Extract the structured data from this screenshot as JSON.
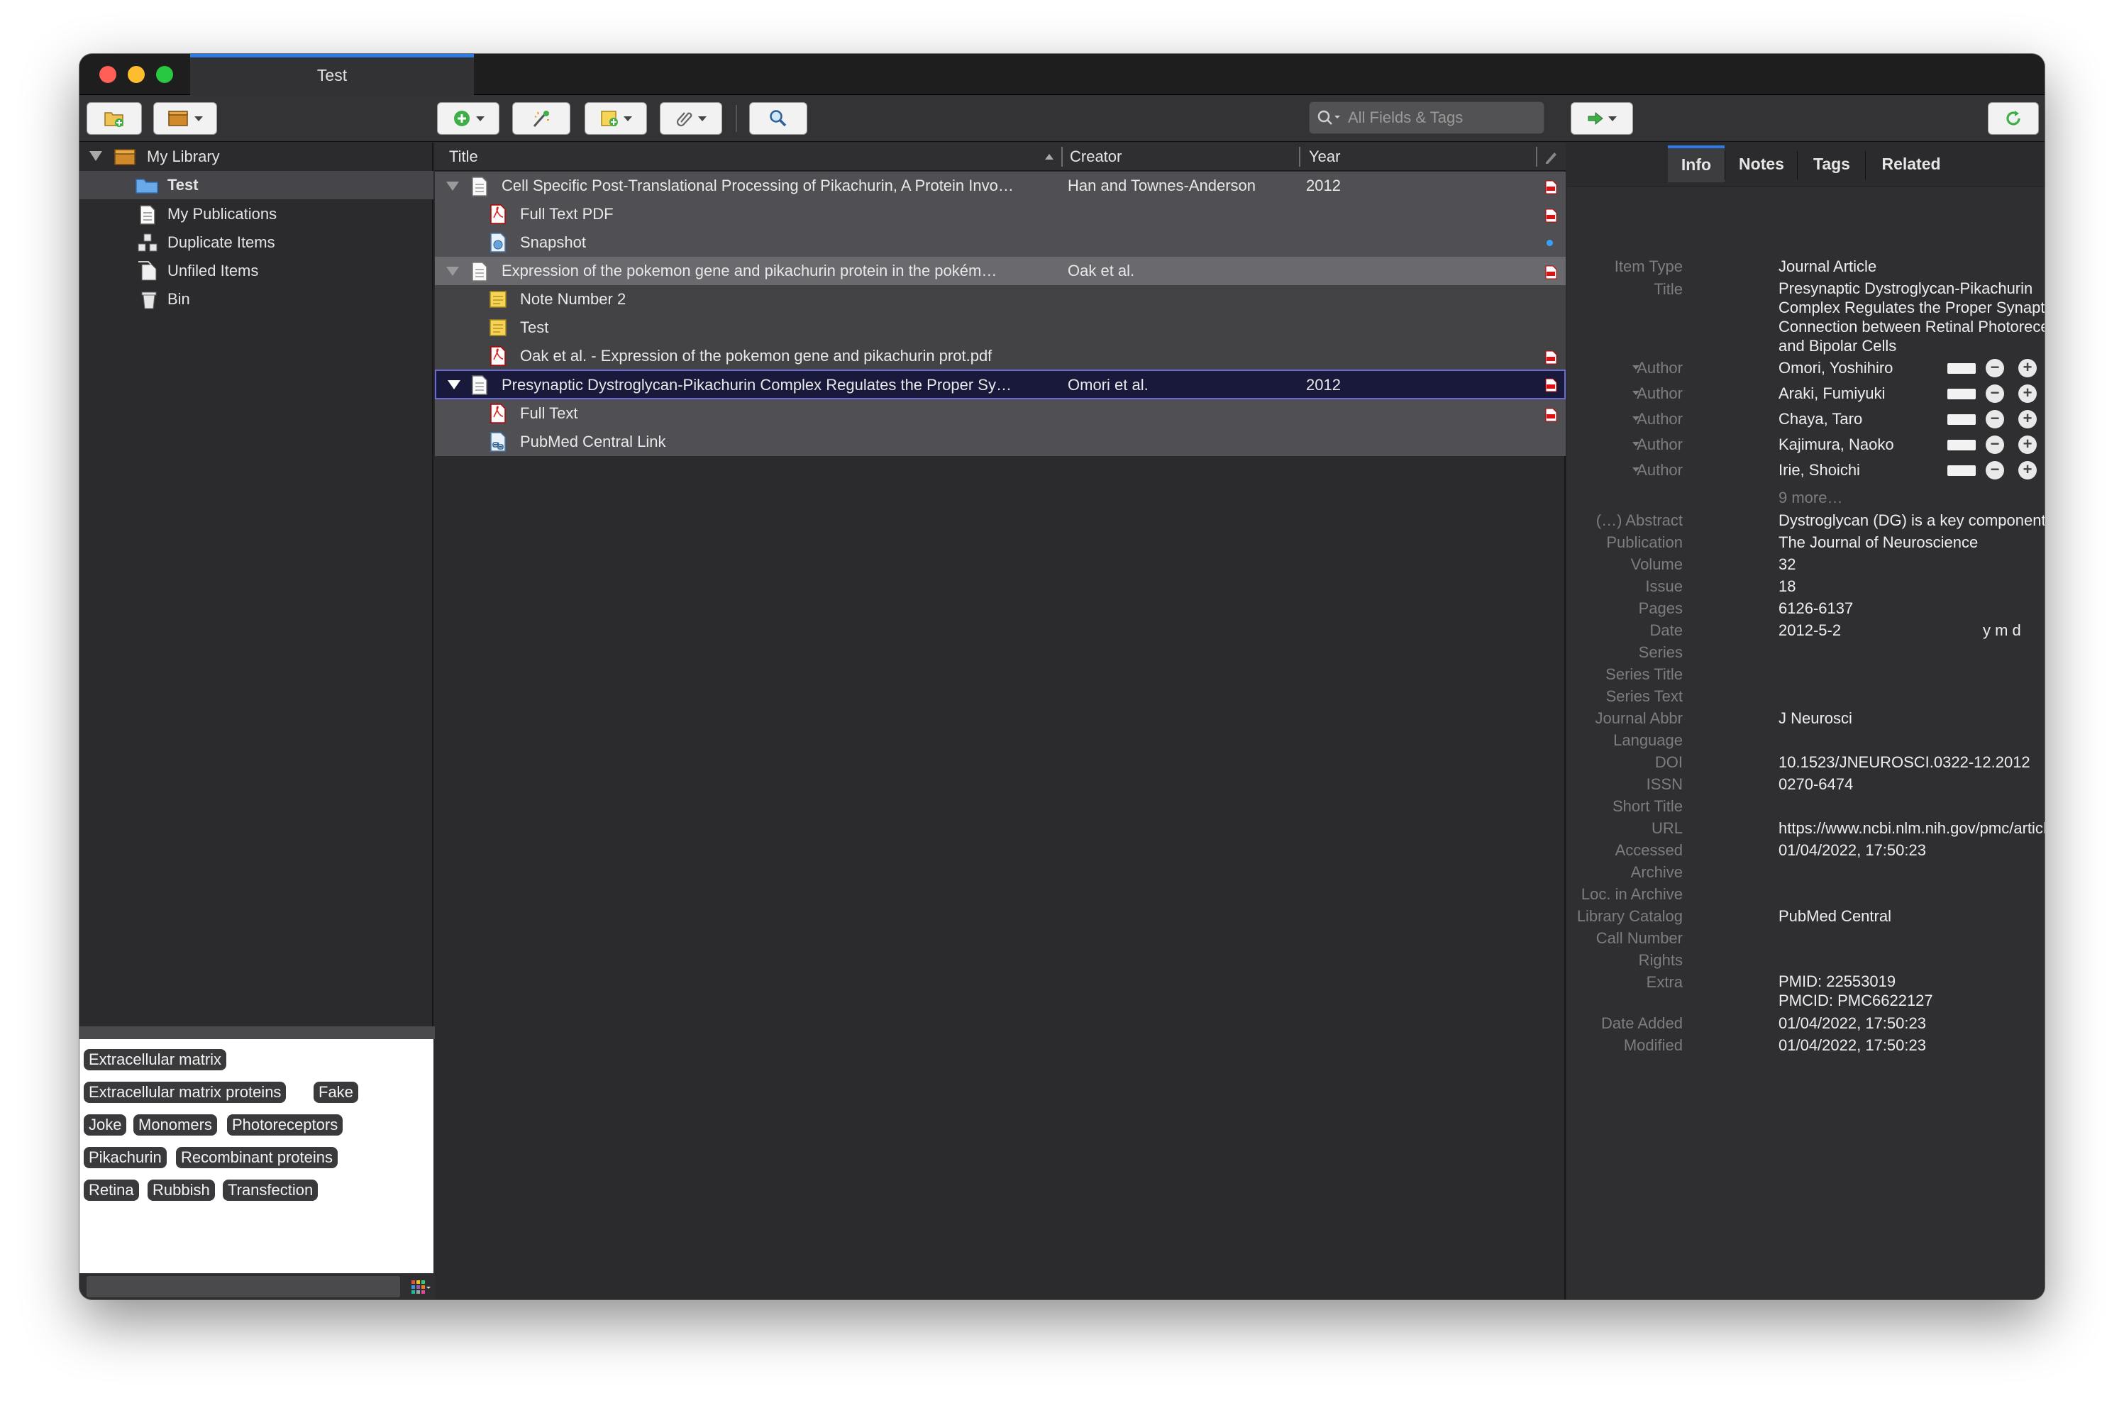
{
  "window": {
    "tab_title": "Test"
  },
  "search": {
    "placeholder": "All Fields & Tags"
  },
  "sidebar": {
    "items": [
      {
        "label": "My Library"
      },
      {
        "label": "Test"
      },
      {
        "label": "My Publications"
      },
      {
        "label": "Duplicate Items"
      },
      {
        "label": "Unfiled Items"
      },
      {
        "label": "Bin"
      }
    ]
  },
  "tags": [
    "Extracellular matrix",
    "Extracellular matrix proteins",
    "Fake",
    "Joke",
    "Monomers",
    "Photoreceptors",
    "Pikachurin",
    "Recombinant proteins",
    "Retina",
    "Rubbish",
    "Transfection"
  ],
  "columns": {
    "title": "Title",
    "creator": "Creator",
    "year": "Year"
  },
  "items": [
    {
      "title": "Cell Specific Post-Translational Processing of Pikachurin, A Protein Invo…",
      "creator": "Han and Townes-Anderson",
      "year": "2012"
    },
    {
      "title": "Full Text PDF"
    },
    {
      "title": "Snapshot"
    },
    {
      "title": "Expression of the pokemon gene and pikachurin protein in the pokém…",
      "creator": "Oak et al.",
      "year": ""
    },
    {
      "title": "Note Number 2"
    },
    {
      "title": "Test"
    },
    {
      "title": "Oak et al. - Expression of the pokemon gene and pikachurin prot.pdf"
    },
    {
      "title": "Presynaptic Dystroglycan-Pikachurin Complex Regulates the Proper Sy…",
      "creator": "Omori et al.",
      "year": "2012"
    },
    {
      "title": "Full Text"
    },
    {
      "title": "PubMed Central Link"
    }
  ],
  "item_pane": {
    "tabs": [
      "Info",
      "Notes",
      "Tags",
      "Related"
    ],
    "item_type_label": "Item Type",
    "item_type": "Journal Article",
    "title_label": "Title",
    "title_lines": [
      "Presynaptic Dystroglycan-Pikachurin",
      "Complex Regulates the Proper Synaptic",
      "Connection between Retinal Photoreceptor",
      "and Bipolar Cells"
    ],
    "author_label": "Author",
    "authors": [
      "Omori, Yoshihiro",
      "Araki, Fumiyuki",
      "Chaya, Taro",
      "Kajimura, Naoko",
      "Irie, Shoichi"
    ],
    "more_authors": "9 more…",
    "abstract_label": "(…) Abstract",
    "abstract": "Dystroglycan (DG) is a key component of t…",
    "publication_label": "Publication",
    "publication": "The Journal of Neuroscience",
    "volume_label": "Volume",
    "volume": "32",
    "issue_label": "Issue",
    "issue": "18",
    "pages_label": "Pages",
    "pages": "6126-6137",
    "date_label": "Date",
    "date": "2012-5-2",
    "date_format": "y m d",
    "series_label": "Series",
    "series_title_label": "Series Title",
    "series_text_label": "Series Text",
    "journal_abbr_label": "Journal Abbr",
    "journal_abbr": "J Neurosci",
    "language_label": "Language",
    "doi_label": "DOI",
    "doi": "10.1523/JNEUROSCI.0322-12.2012",
    "issn_label": "ISSN",
    "issn": "0270-6474",
    "short_title_label": "Short Title",
    "url_label": "URL",
    "url": "https://www.ncbi.nlm.nih.gov/pmc/articl…",
    "accessed_label": "Accessed",
    "accessed": "01/04/2022, 17:50:23",
    "archive_label": "Archive",
    "loc_archive_label": "Loc. in Archive",
    "library_catalog_label": "Library Catalog",
    "library_catalog": "PubMed Central",
    "call_number_label": "Call Number",
    "rights_label": "Rights",
    "extra_label": "Extra",
    "extra_line1": "PMID: 22553019",
    "extra_line2": "PMCID: PMC6622127",
    "date_added_label": "Date Added",
    "date_added": "01/04/2022, 17:50:23",
    "modified_label": "Modified",
    "modified": "01/04/2022, 17:50:23"
  },
  "colors": {
    "accent": "#2c7be5",
    "selection": "#19193b",
    "tag_bg": "#3a3a3c"
  }
}
